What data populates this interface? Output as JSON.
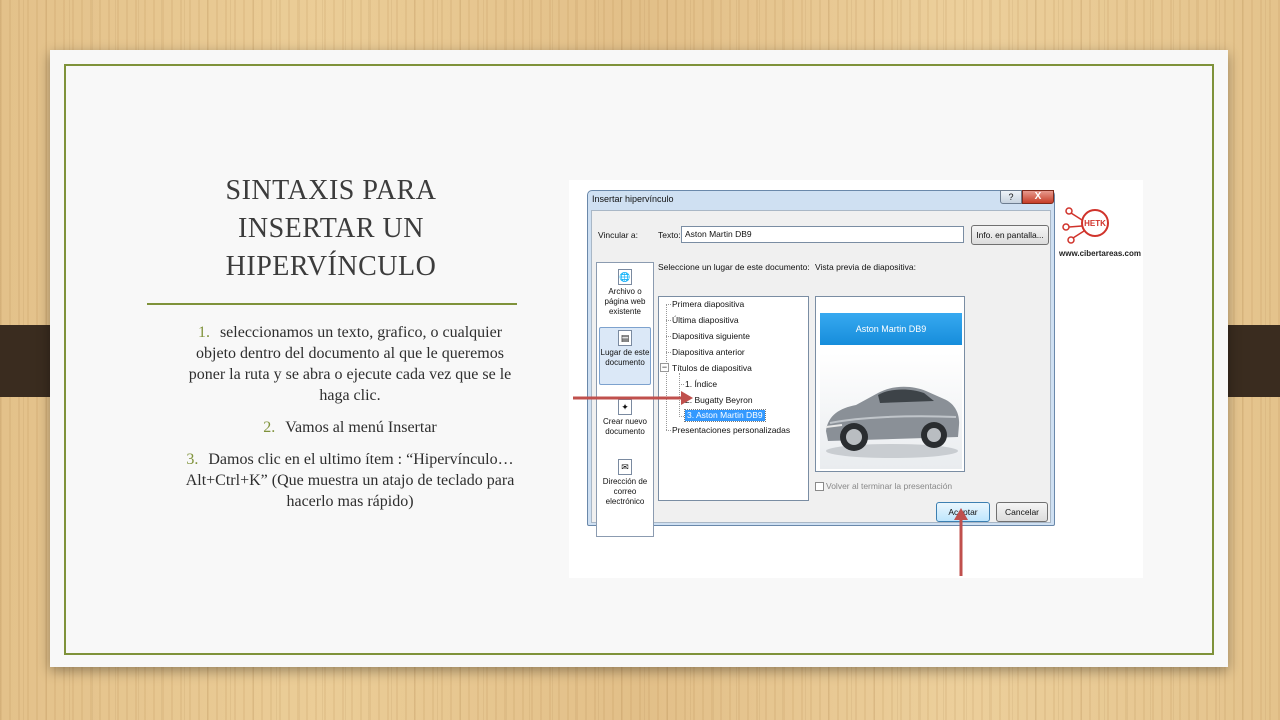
{
  "slide": {
    "title_lines": [
      "SINTAXIS PARA",
      "INSERTAR UN",
      "HIPERVÍNCULO"
    ],
    "steps": [
      {
        "num": "1.",
        "text": "seleccionamos un texto, grafico, o cualquier objeto dentro del documento al que le queremos poner la ruta y se abra o ejecute cada vez que se le haga clic."
      },
      {
        "num": "2.",
        "text": "Vamos al menú Insertar"
      },
      {
        "num": "3.",
        "text": "Damos clic en el ultimo ítem : “Hipervínculo…Alt+Ctrl+K” (Que muestra un atajo de teclado para hacerlo mas rápido)"
      }
    ]
  },
  "dialog": {
    "title": "Insertar hipervínculo",
    "help_label": "?",
    "close_label": "X",
    "link_to_label": "Vincular a:",
    "text_label": "Texto:",
    "text_value": "Aston Martin DB9",
    "screentip_button": "Info. en pantalla...",
    "select_place_label": "Seleccione un lugar de este documento:",
    "preview_label": "Vista previa de diapositiva:",
    "sidebar": [
      {
        "label": "Archivo o página web existente",
        "icon": "web-page-icon"
      },
      {
        "label": "Lugar de este documento",
        "icon": "document-place-icon"
      },
      {
        "label": "Crear nuevo documento",
        "icon": "new-document-icon"
      },
      {
        "label": "Dirección de correo electrónico",
        "icon": "email-icon"
      }
    ],
    "tree": [
      "Primera diapositiva",
      "Última diapositiva",
      "Diapositiva siguiente",
      "Diapositiva anterior",
      "Títulos de diapositiva",
      "1. Índice",
      "2. Bugatty Beyron",
      "3. Aston Martin DB9",
      "Presentaciones personalizadas"
    ],
    "tree_selected": "3. Aston Martin DB9",
    "preview_title": "Aston Martin DB9",
    "show_after_label": "Volver al terminar la presentación",
    "show_after_checked": false,
    "ok_button": "Aceptar",
    "cancel_button": "Cancelar"
  },
  "logo": {
    "text": "HETK",
    "url": "www.cibertareas.com"
  },
  "colors": {
    "accent": "#7f923a",
    "arrow": "#c0504d",
    "selection": "#3399ff",
    "banner": "#1f96e3"
  }
}
